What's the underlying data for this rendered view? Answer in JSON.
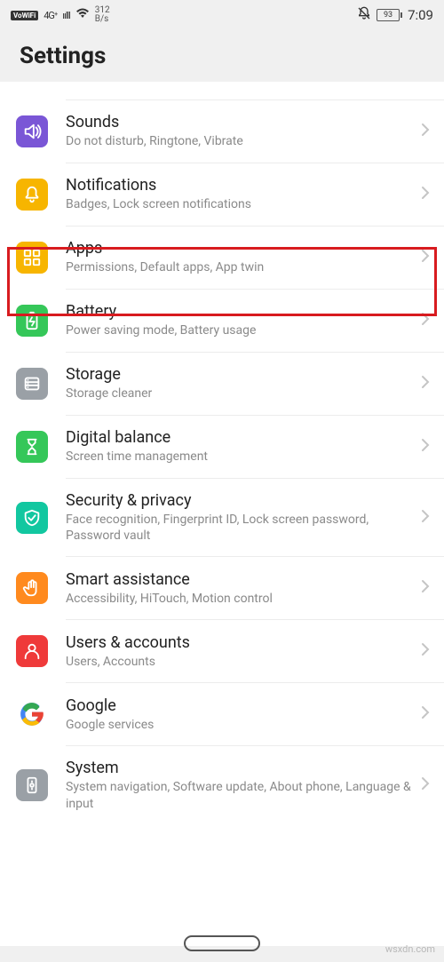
{
  "status": {
    "vowifi": "VoWiFi",
    "signal_type": "4G⁺",
    "speed": "312",
    "speed_unit": "B/s",
    "battery": "93",
    "time": "7:09"
  },
  "header": {
    "title": "Settings"
  },
  "items": [
    {
      "title": "Sounds",
      "subtitle": "Do not disturb, Ringtone, Vibrate",
      "icon_bg": "#7a56d6",
      "icon": "sound"
    },
    {
      "title": "Notifications",
      "subtitle": "Badges, Lock screen notifications",
      "icon_bg": "#f7b500",
      "icon": "bell"
    },
    {
      "title": "Apps",
      "subtitle": "Permissions, Default apps, App twin",
      "icon_bg": "#f7b500",
      "icon": "apps"
    },
    {
      "title": "Battery",
      "subtitle": "Power saving mode, Battery usage",
      "icon_bg": "#35c759",
      "icon": "battery"
    },
    {
      "title": "Storage",
      "subtitle": "Storage cleaner",
      "icon_bg": "#9aa0a6",
      "icon": "storage"
    },
    {
      "title": "Digital balance",
      "subtitle": "Screen time management",
      "icon_bg": "#35c759",
      "icon": "hourglass"
    },
    {
      "title": "Security & privacy",
      "subtitle": "Face recognition, Fingerprint ID, Lock screen password, Password vault",
      "icon_bg": "#12c7a0",
      "icon": "shield"
    },
    {
      "title": "Smart assistance",
      "subtitle": "Accessibility, HiTouch, Motion control",
      "icon_bg": "#ff8a1e",
      "icon": "hand"
    },
    {
      "title": "Users & accounts",
      "subtitle": "Users, Accounts",
      "icon_bg": "#ef3a3a",
      "icon": "user"
    },
    {
      "title": "Google",
      "subtitle": "Google services",
      "icon_bg": "#ffffff",
      "icon": "google"
    },
    {
      "title": "System",
      "subtitle": "System navigation, Software update, About phone, Language & input",
      "icon_bg": "#9aa0a6",
      "icon": "system"
    }
  ],
  "watermark": "wsxdn.com"
}
